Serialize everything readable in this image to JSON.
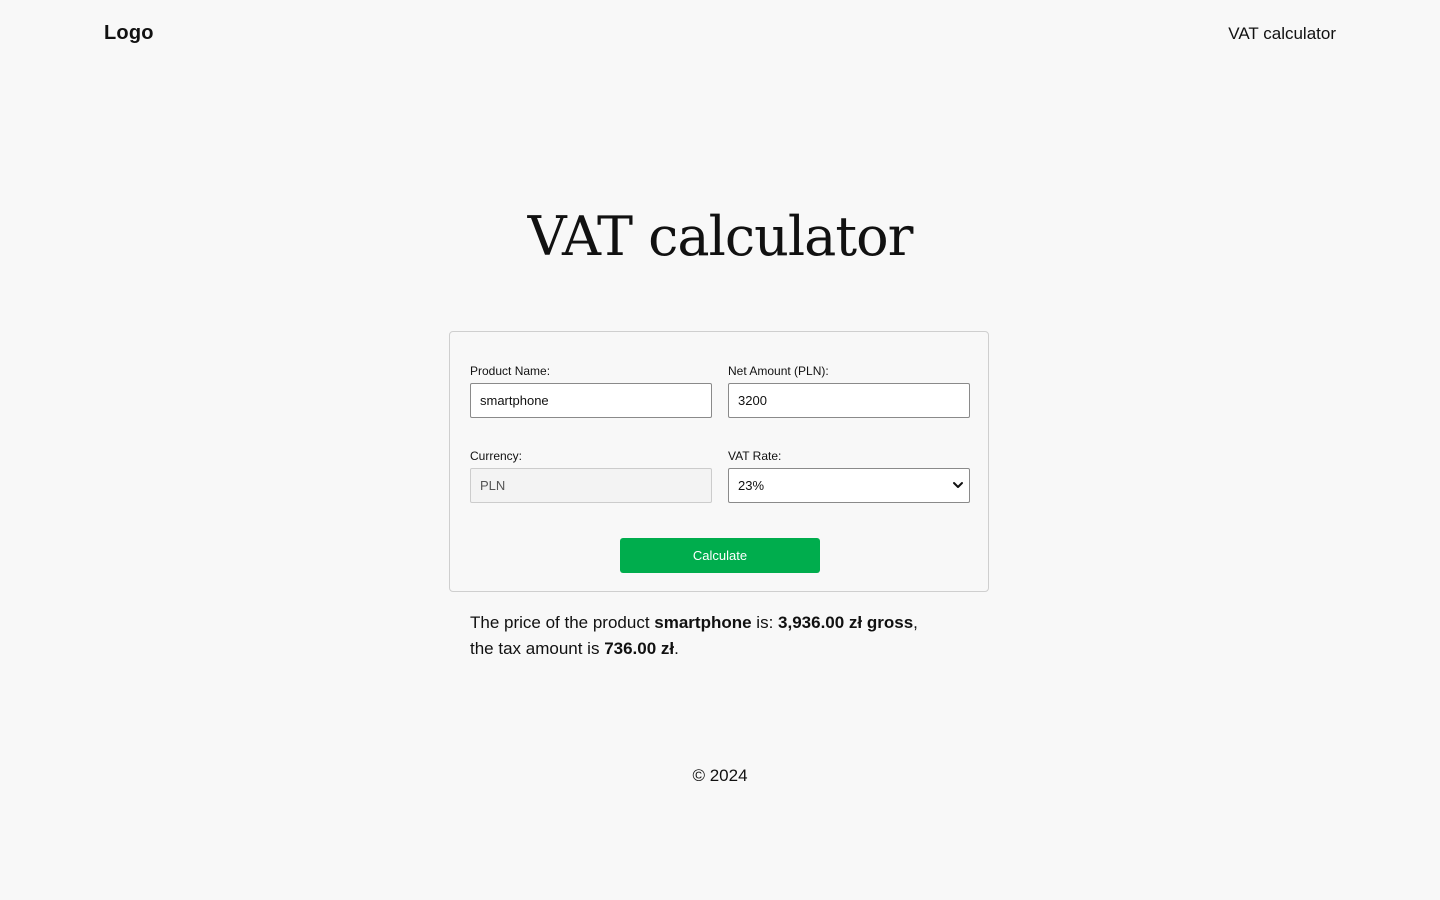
{
  "header": {
    "logo": "Logo",
    "nav_link": "VAT calculator"
  },
  "page_title": "VAT calculator",
  "form": {
    "product_name": {
      "label": "Product Name:",
      "value": "smartphone"
    },
    "net_amount": {
      "label": "Net Amount (PLN):",
      "value": "3200"
    },
    "currency": {
      "label": "Currency:",
      "value": "PLN"
    },
    "vat_rate": {
      "label": "VAT Rate:",
      "selected": "23%"
    },
    "calculate_label": "Calculate"
  },
  "result": {
    "prefix": "The price of the product ",
    "product": "smartphone",
    "middle": " is: ",
    "gross": "3,936.00 zł gross",
    "comma": ",",
    "tax_prefix": "the tax amount is ",
    "tax": "736.00 zł",
    "suffix": "."
  },
  "footer": {
    "copyright": "© 2024"
  },
  "colors": {
    "background": "#f8f8f8",
    "accent_button": "#00ad4d",
    "text": "#111111"
  },
  "icons": {
    "select_arrow": "chevron-down-icon"
  }
}
